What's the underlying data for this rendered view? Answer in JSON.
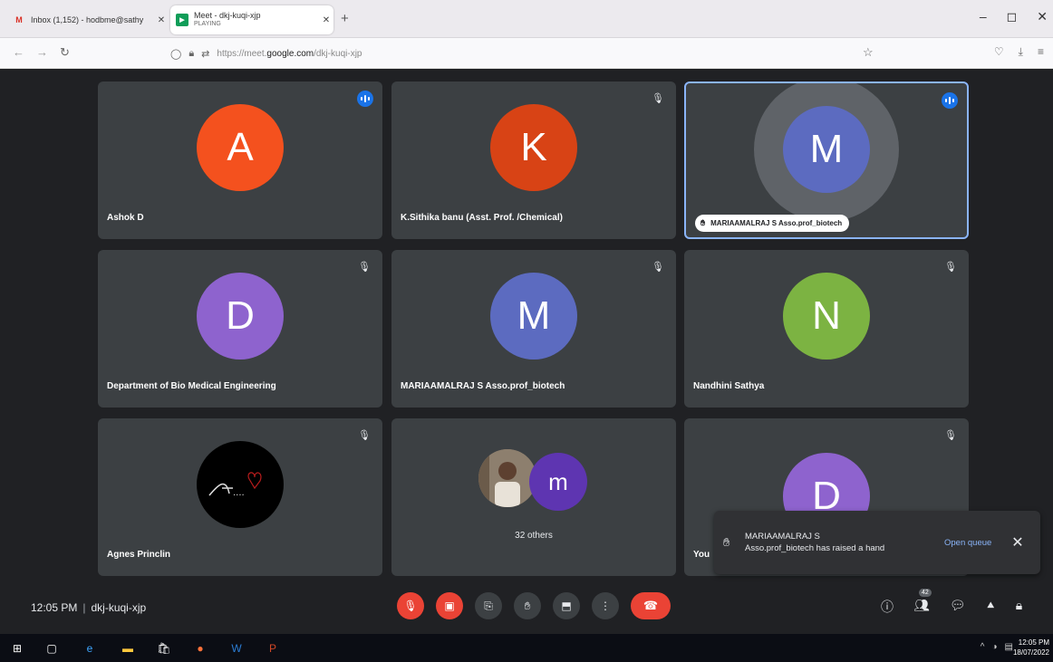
{
  "browser": {
    "tabs": [
      {
        "label": "Inbox (1,152) - hodbme@sathy",
        "icon": "gmail-icon"
      },
      {
        "label": "Meet - dkj-kuqi-xjp",
        "sublabel": "PLAYING",
        "icon": "meet-icon"
      }
    ],
    "url": {
      "prefix": "https://meet.",
      "domain": "google.com",
      "path": "/dkj-kuqi-xjp"
    }
  },
  "tiles": [
    {
      "name": "Ashok D",
      "initial": "A",
      "color": "#f4511e",
      "status": "speaking"
    },
    {
      "name": "K.Sithika banu (Asst. Prof. /Chemical)",
      "initial": "K",
      "color": "#d84315",
      "status": "muted"
    },
    {
      "name": "MARIAAMALRAJ S Asso.prof_biotech",
      "initial": "M",
      "color": "#5c6bc0",
      "status": "speaking",
      "hand_raised": true
    },
    {
      "name": "Department of Bio Medical Engineering",
      "initial": "D",
      "color": "#8e63ce",
      "status": "muted"
    },
    {
      "name": "MARIAAMALRAJ S Asso.prof_biotech",
      "initial": "M",
      "color": "#5c6bc0",
      "status": "muted"
    },
    {
      "name": "Nandhini Sathya",
      "initial": "N",
      "color": "#7cb342",
      "status": "muted"
    },
    {
      "name": "Agnes Princlin",
      "initial": "",
      "color": "#000000",
      "status": "muted",
      "avatar_text": "A....",
      "avatar_type": "signature-image"
    },
    {
      "name": "",
      "initial": "m",
      "color": "#5e35b1",
      "status": "none",
      "others_label": "32 others"
    },
    {
      "name": "You",
      "initial": "D",
      "color": "#8e63ce",
      "status": "muted"
    }
  ],
  "toast": {
    "message_line1": "MARIAAMALRAJ S",
    "message_line2": "Asso.prof_biotech has raised a hand",
    "action": "Open queue",
    "close": "✕"
  },
  "bottom": {
    "time": "12:05 PM",
    "separator": "|",
    "meeting_code": "dkj-kuqi-xjp",
    "controls": [
      "mic-off-icon",
      "camera-off-icon",
      "captions-icon",
      "raise-hand-icon",
      "present-icon",
      "more-options-icon",
      "end-call-icon"
    ],
    "right_controls": [
      "info-icon",
      "people-icon",
      "chat-icon",
      "activities-icon",
      "host-controls-icon"
    ],
    "people_count": "42"
  },
  "taskbar": {
    "time": "12:05 PM",
    "date": "18/07/2022"
  }
}
